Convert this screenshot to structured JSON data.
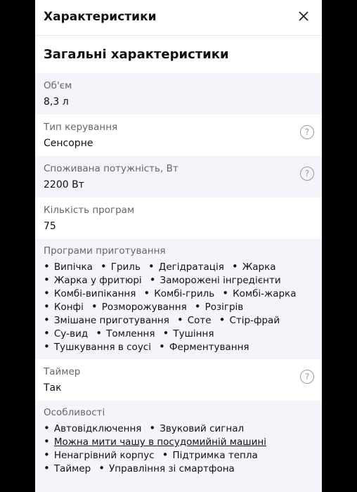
{
  "dialog": {
    "title": "Характеристики",
    "section_title": "Загальні характеристики"
  },
  "specs": [
    {
      "label": "Об'єм",
      "value": "8,3 л"
    },
    {
      "label": "Тип керування",
      "value": "Сенсорне",
      "help": "?"
    },
    {
      "label": "Споживана потужність, Вт",
      "value": "2200 Вт",
      "help": "?"
    },
    {
      "label": "Кількість програм",
      "value": "75"
    }
  ],
  "programs": {
    "label": "Програми приготування",
    "items": [
      "Випічка",
      "Гриль",
      "Дегідратація",
      "Жарка",
      "Жарка у фритюрі",
      "Заморожені інгредієнти",
      "Комбі-випікання",
      "Комбі-гриль",
      "Комбі-жарка",
      "Конфі",
      "Розморожування",
      "Розігрів",
      "Змішане приготування",
      "Соте",
      "Стір-фрай",
      "Су-вид",
      "Томлення",
      "Тушіння",
      "Тушкування в соусі",
      "Ферментування"
    ]
  },
  "timer": {
    "label": "Таймер",
    "value": "Так",
    "help": "?"
  },
  "features": {
    "label": "Особливості",
    "items": [
      "Автовідключення",
      "Звуковий сигнал",
      "Можна мити чашу в посудомийній машині",
      "Ненагрівний корпус",
      "Підтримка тепла",
      "Таймер",
      "Управління зі смартфона"
    ],
    "link_item": "Можна мити чашу в посудомийній машині"
  }
}
